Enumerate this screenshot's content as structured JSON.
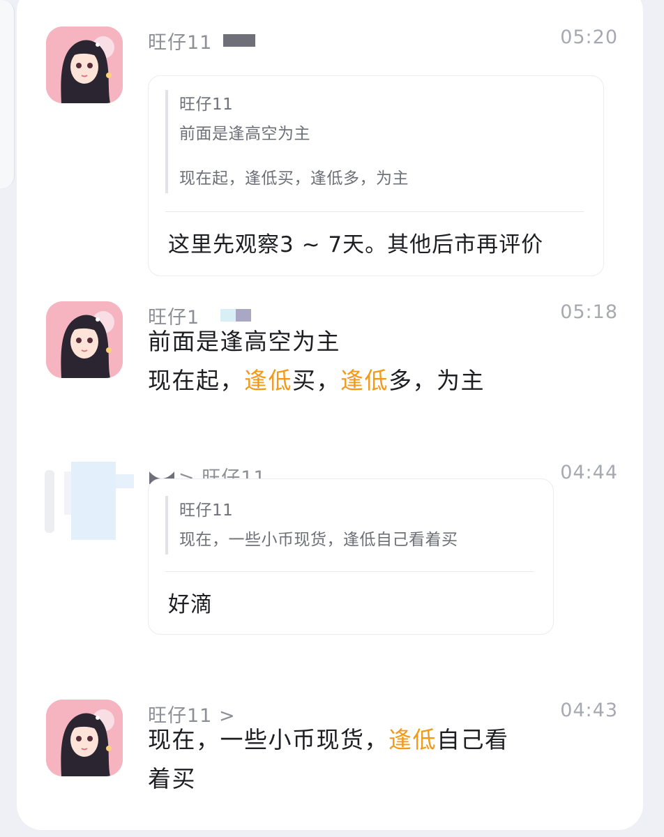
{
  "colors": {
    "highlight": "#f29a18",
    "sender": "#8d8f96",
    "time": "#a7a9b0",
    "text": "#1d1e22"
  },
  "messages": [
    {
      "sender": "旺仔11",
      "time": "05:20",
      "avatar": "anime-girl-avatar",
      "quote": {
        "author": "旺仔11",
        "line1": "前面是逢高空为主",
        "line2": "现在起，逢低买，逢低多，为主"
      },
      "reply": "这里先观察3 ~ 7天。其他后市再评价"
    },
    {
      "sender": "旺仔1",
      "time": "05:18",
      "avatar": "anime-girl-avatar",
      "line1": "前面是逢高空为主",
      "line2": {
        "p1": "现在起，",
        "hl1": "逢低",
        "p2": "买，",
        "hl2": "逢低",
        "p3": "多，为主"
      }
    },
    {
      "sender": "> 旺仔11",
      "time": "04:44",
      "avatar": "blurred-avatar",
      "quote": {
        "author": "旺仔11",
        "line1": "现在，一些小币现货，逢低自己看着买"
      },
      "reply": "好滴"
    },
    {
      "sender": "旺仔11 >",
      "time": "04:43",
      "avatar": "anime-girl-avatar",
      "line1": {
        "p1": "现在，一些小币现货，",
        "hl1": "逢低",
        "p2": "自己看"
      },
      "line2": "着买"
    }
  ]
}
